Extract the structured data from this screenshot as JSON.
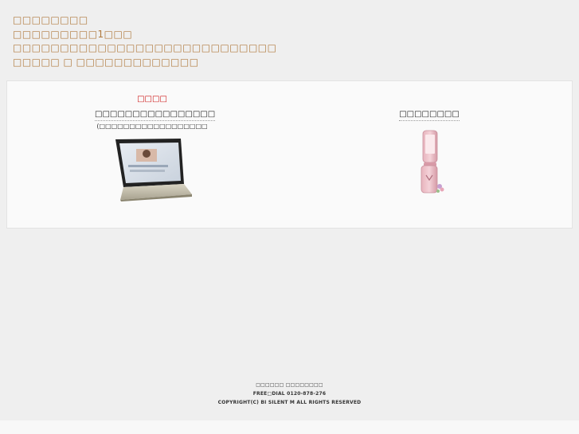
{
  "notice": {
    "lines": [
      "□□□□□□□□",
      "□□□□□□□□□1□□□",
      "□□□□□□□□□□□□□□□□□□□□□□□□□□□□",
      "□□□□□ □ □□□□□□□□□□□□□"
    ]
  },
  "options": {
    "pc": {
      "recommend": "□□□□",
      "label": "□□□□□□□□□□□□□□□□",
      "sub": "(□□□□□□□□□□□□□□□□□□",
      "icon": "laptop-icon"
    },
    "mobile": {
      "label": "□□□□□□□□",
      "icon": "flip-phone-icon"
    }
  },
  "footer": {
    "company": "□□□□□□ □□□□□□□□",
    "freedial": "FREE□DIAL 0120-878-276",
    "copyright": "COPYRIGHT(C) BI SILENT M ALL RIGHTS RESERVED"
  },
  "colors": {
    "notice_text": "#b07a3e",
    "recommend_text": "#cc1111",
    "background": "#efefef",
    "panel": "#fafafa"
  }
}
